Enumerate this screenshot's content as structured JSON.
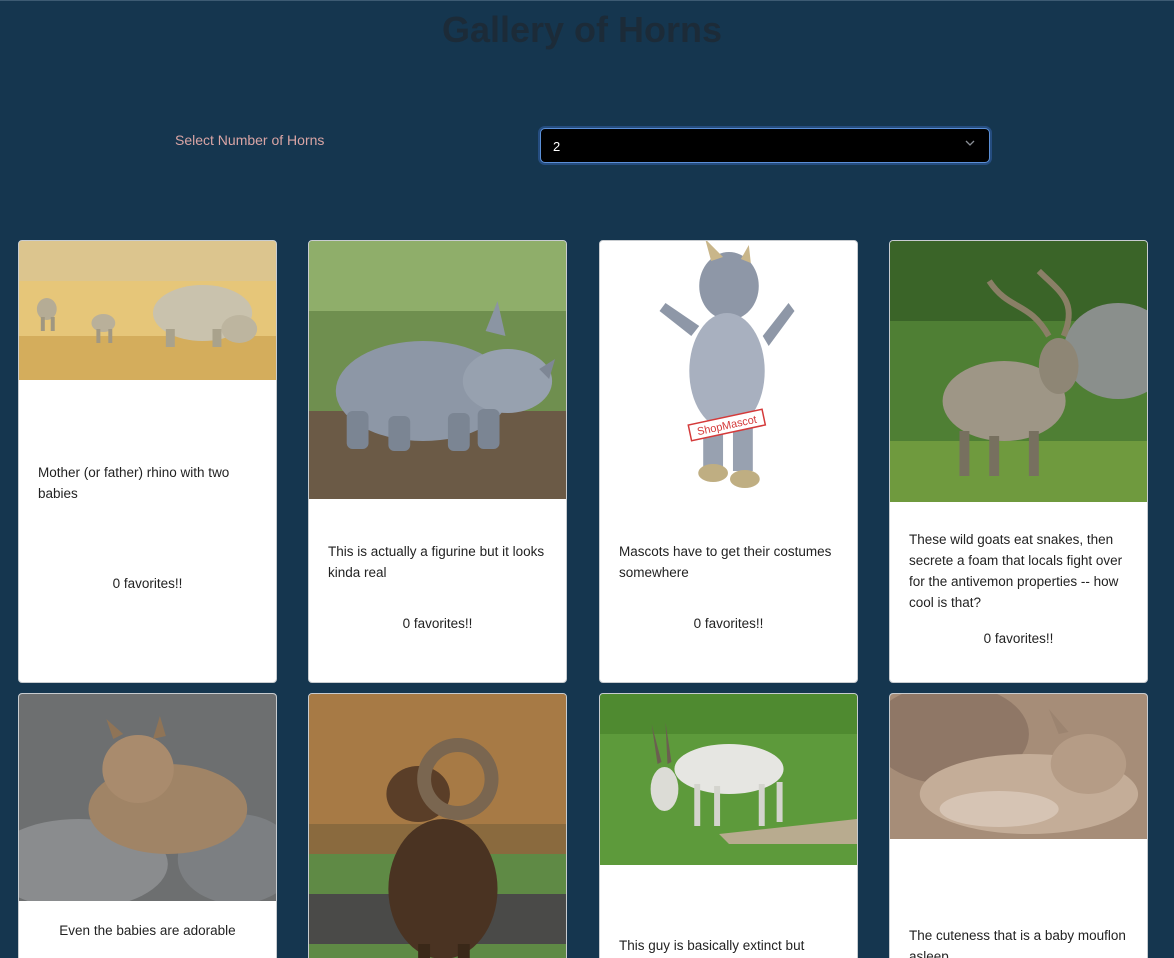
{
  "page": {
    "title": "Gallery of Horns"
  },
  "filter": {
    "label": "Select Number of Horns",
    "selected": "2"
  },
  "cards": [
    {
      "description": "Mother (or father) rhino with two babies",
      "favorites": "0 favorites!!",
      "image": "rhino-family-photo"
    },
    {
      "description": "This is actually a figurine but it looks kinda real",
      "favorites": "0 favorites!!",
      "image": "rhino-figurine-photo"
    },
    {
      "description": "Mascots have to get their costumes somewhere",
      "favorites": "0 favorites!!",
      "image": "rhino-mascot-photo",
      "watermark": "ShopMascot"
    },
    {
      "description": "These wild goats eat snakes, then secrete a foam that locals fight over for the antivemon properties -- how cool is that?",
      "favorites": "0 favorites!!",
      "image": "markhor-goat-photo"
    },
    {
      "description": "Even the babies are adorable",
      "favorites": "",
      "image": "baby-goat-photo"
    },
    {
      "description": "",
      "favorites": "",
      "image": "mouflon-ram-photo"
    },
    {
      "description": "This guy is basically extinct but",
      "favorites": "",
      "image": "addax-antelope-photo"
    },
    {
      "description": "The cuteness that is a baby mouflon asleep",
      "favorites": "",
      "image": "baby-mouflon-photo"
    }
  ]
}
